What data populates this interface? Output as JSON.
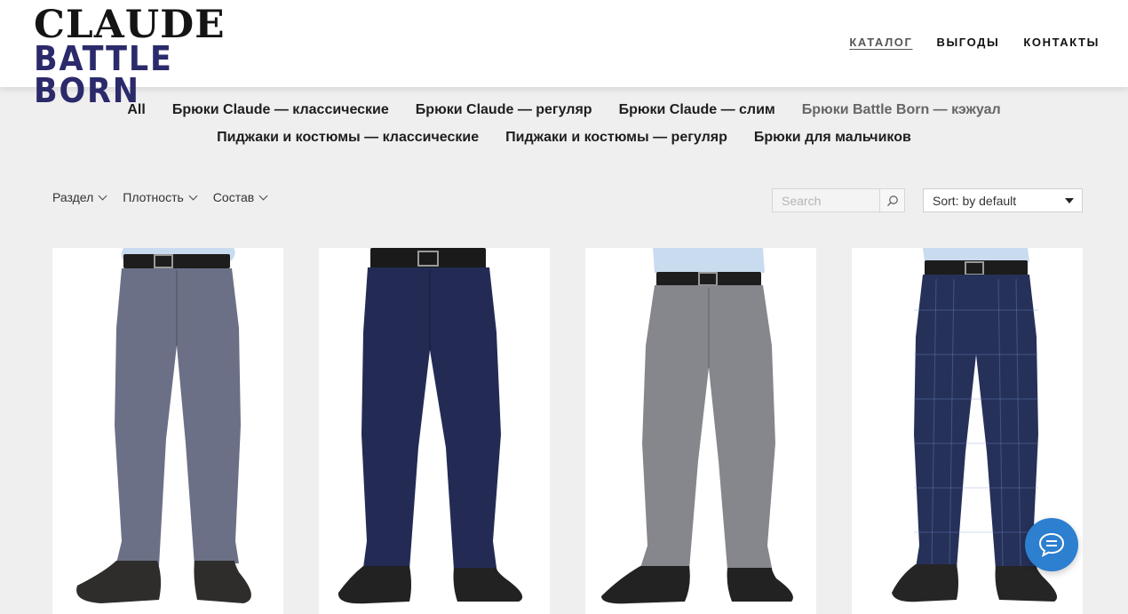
{
  "logo": {
    "top": "CLAUDE",
    "bottom": "BATTLE BORN"
  },
  "nav": [
    {
      "label": "КАТАЛОГ",
      "active": true
    },
    {
      "label": "ВЫГОДЫ",
      "active": false
    },
    {
      "label": "КОНТАКТЫ",
      "active": false
    }
  ],
  "categories": {
    "row1": [
      "All",
      "Брюки Claude — классические",
      "Брюки Claude — регуляр",
      "Брюки Claude — слим",
      "Брюки Battle Born — кэжуал"
    ],
    "row2": [
      "Пиджаки и костюмы — классические",
      "Пиджаки и костюмы — регуляр",
      "Брюки для мальчиков"
    ]
  },
  "filters": [
    "Раздел",
    "Плотность",
    "Состав"
  ],
  "search": {
    "placeholder": "Search"
  },
  "sort": {
    "label": "Sort: by default"
  },
  "products": [
    {
      "image": "grey-blue trousers",
      "color": "#6b7086"
    },
    {
      "image": "navy trousers",
      "color": "#232b55"
    },
    {
      "image": "grey trousers",
      "color": "#86878d"
    },
    {
      "image": "navy check trousers",
      "color": "#26315a"
    }
  ],
  "icons": {
    "search": "search-icon",
    "chat": "chat-bubble-icon"
  },
  "colors": {
    "brand_navy": "#2b2a6b",
    "chat_blue": "#2d7fd0"
  }
}
